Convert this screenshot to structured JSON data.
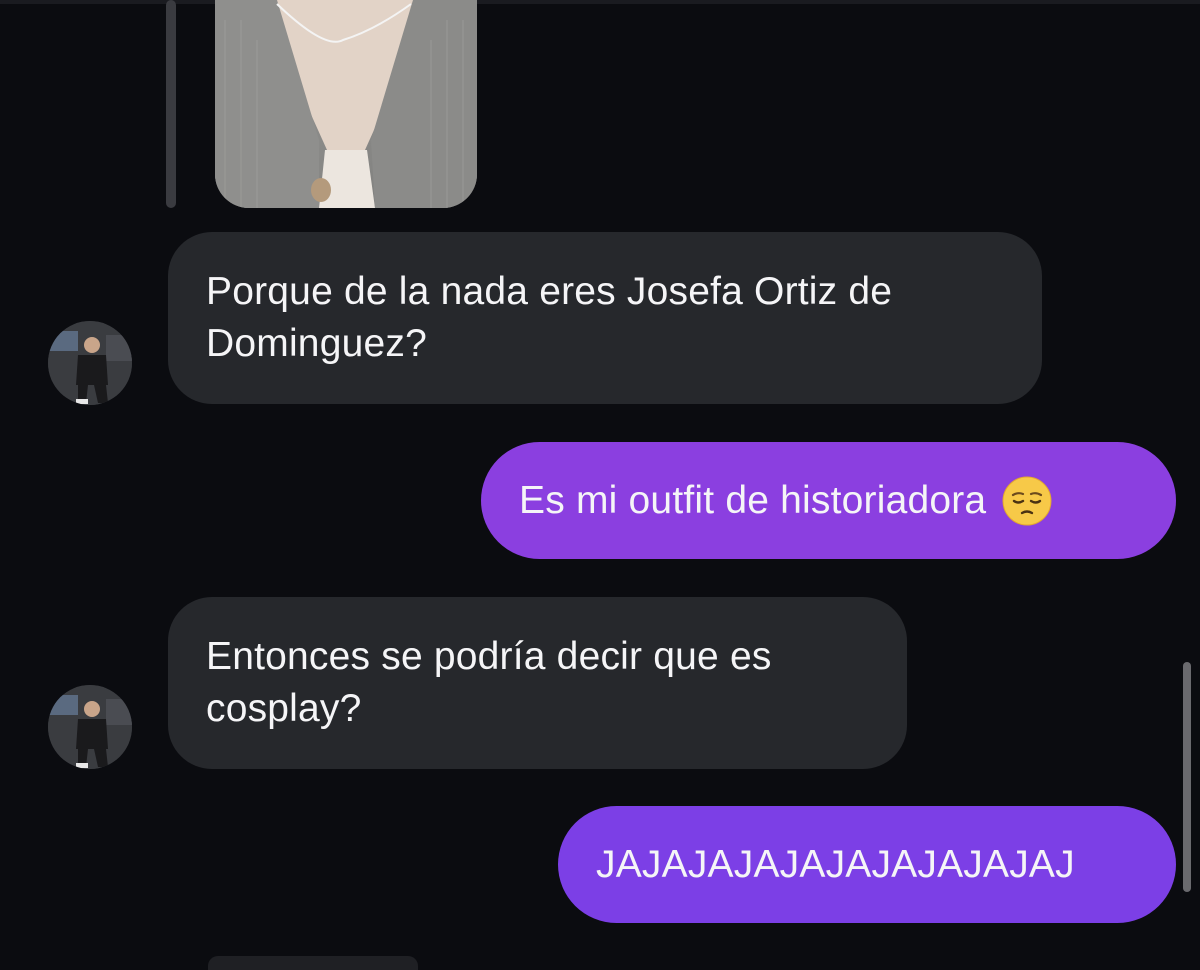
{
  "messages": [
    {
      "from": "other",
      "text": "Porque de la nada eres Josefa Ortiz de Dominguez?"
    },
    {
      "from": "me",
      "text": "Es mi outfit de historiadora",
      "emoji": "pensive-face-icon"
    },
    {
      "from": "other",
      "text": "Entonces se podría decir que es cosplay?"
    },
    {
      "from": "me",
      "text": "JAJAJAJAJAJAJAJAJAJAJ"
    }
  ],
  "colors": {
    "background": "#0b0c10",
    "incoming_bubble": "#26282c",
    "outgoing_bubble_a": "#8b3fe0",
    "outgoing_bubble_b": "#7c3fe6",
    "text": "#f5f5f7"
  },
  "icons": {
    "shared_photo": "photo-grey-cardigan",
    "avatar": "contact-avatar"
  }
}
